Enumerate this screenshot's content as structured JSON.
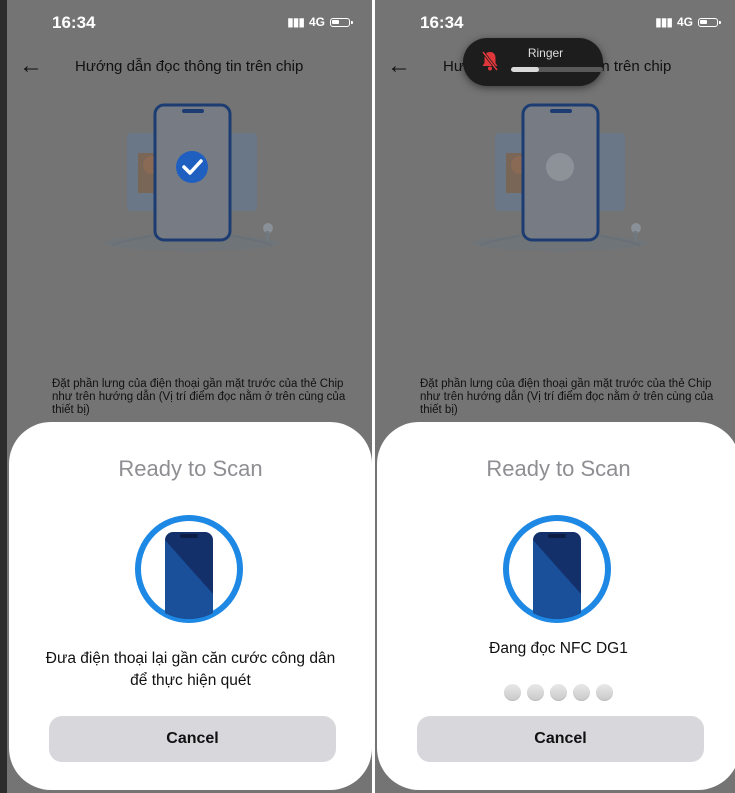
{
  "screens": [
    {
      "status": {
        "time": "16:34",
        "network": "4G"
      },
      "nav": {
        "title": "Hướng dẫn đọc thông tin trên chip"
      },
      "instruction": "Đặt phần lưng của điện thoại gần mặt trước của thẻ Chip như trên hướng dẫn (Vị trí điểm đọc nằm ở trên cùng của thiết bị)",
      "sheet": {
        "title": "Ready to Scan",
        "message": "Đưa điện thoại lại gần căn cước công dân để thực hiện quét",
        "cancel_label": "Cancel"
      }
    },
    {
      "status": {
        "time": "16:34",
        "network": "4G"
      },
      "nav": {
        "title": "Hướng dẫn đọc thông tin trên chip"
      },
      "ringer": {
        "label": "Ringer",
        "level": 0.3
      },
      "instruction": "Đặt phần lưng của điện thoại gần mặt trước của thẻ Chip như trên hướng dẫn (Vị trí điểm đọc nằm ở trên cùng của thiết bị)",
      "sheet": {
        "title": "Ready to Scan",
        "message": "Đang đọc NFC DG1",
        "progress_steps": 5,
        "cancel_label": "Cancel"
      }
    }
  ],
  "colors": {
    "overlay": "#747474",
    "accent": "#1e88e5",
    "sheet_bg": "#ffffff",
    "button_bg": "#d7d7dc",
    "ringer_muted": "#e0383a"
  },
  "icons": [
    "back-arrow-icon",
    "signal-icon",
    "battery-icon",
    "checkmark-icon",
    "bell-muted-icon",
    "nfc-phone-icon"
  ]
}
